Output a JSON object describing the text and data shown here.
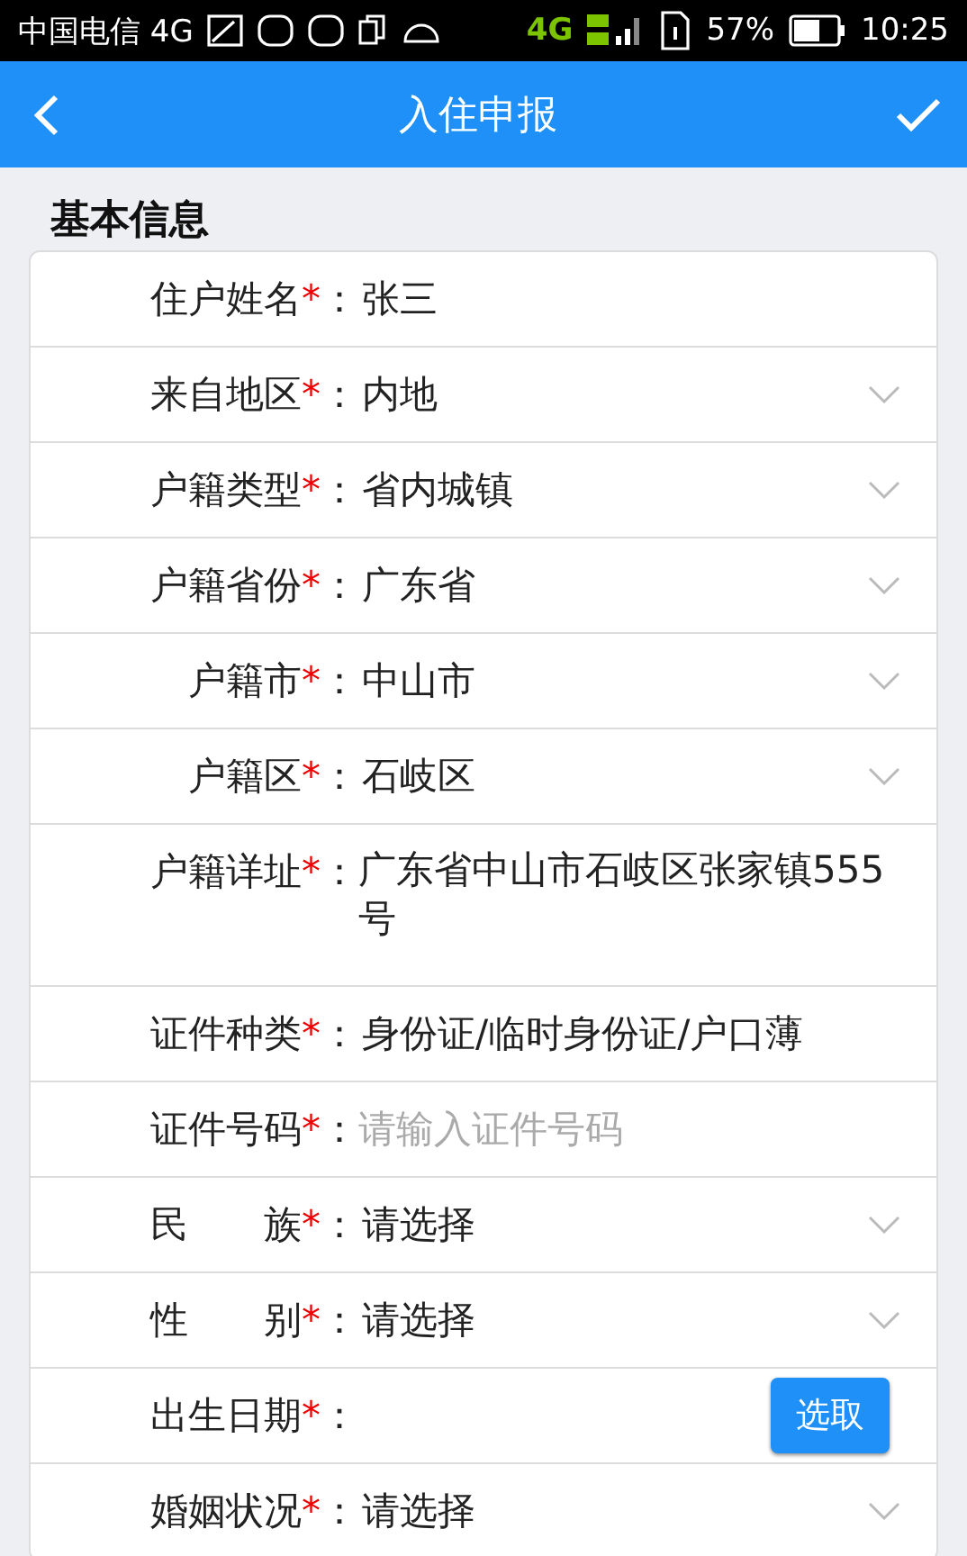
{
  "status_bar": {
    "carrier": "中国电信 4G",
    "network": "4G",
    "battery": "57%",
    "time": "10:25"
  },
  "header": {
    "title": "入住申报"
  },
  "section": {
    "title": "基本信息"
  },
  "fields": [
    {
      "kind": "text",
      "label": "住户姓名",
      "required_mark": "*",
      "colon": "：",
      "value": "张三"
    },
    {
      "kind": "select",
      "label": "来自地区",
      "required_mark": "*",
      "colon": "：",
      "value": "内地"
    },
    {
      "kind": "select",
      "label": "户籍类型",
      "required_mark": "*",
      "colon": "：",
      "value": "省内城镇"
    },
    {
      "kind": "select",
      "label": "户籍省份",
      "required_mark": "*",
      "colon": "：",
      "value": "广东省"
    },
    {
      "kind": "select",
      "label": "户籍市",
      "required_mark": "*",
      "colon": "：",
      "value": "中山市"
    },
    {
      "kind": "select",
      "label": "户籍区",
      "required_mark": "*",
      "colon": "：",
      "value": "石岐区"
    },
    {
      "kind": "textarea",
      "label": "户籍详址",
      "required_mark": "*",
      "colon": "：",
      "value": "广东省中山市石岐区张家镇555号"
    },
    {
      "kind": "text",
      "label": "证件种类",
      "required_mark": "*",
      "colon": "：",
      "value": "身份证/临时身份证/户口薄"
    },
    {
      "kind": "input",
      "label": "证件号码",
      "required_mark": "*",
      "colon": "：",
      "placeholder": "请输入证件号码"
    },
    {
      "kind": "select",
      "label": "民　　族",
      "required_mark": "*",
      "colon": "：",
      "value": "请选择"
    },
    {
      "kind": "select",
      "label": "性　　别",
      "required_mark": "*",
      "colon": "：",
      "value": "请选择"
    },
    {
      "kind": "date",
      "label": "出生日期",
      "required_mark": "*",
      "colon": "：",
      "button": "选取"
    },
    {
      "kind": "select",
      "label": "婚姻状况",
      "required_mark": "*",
      "colon": "：",
      "value": "请选择"
    }
  ]
}
